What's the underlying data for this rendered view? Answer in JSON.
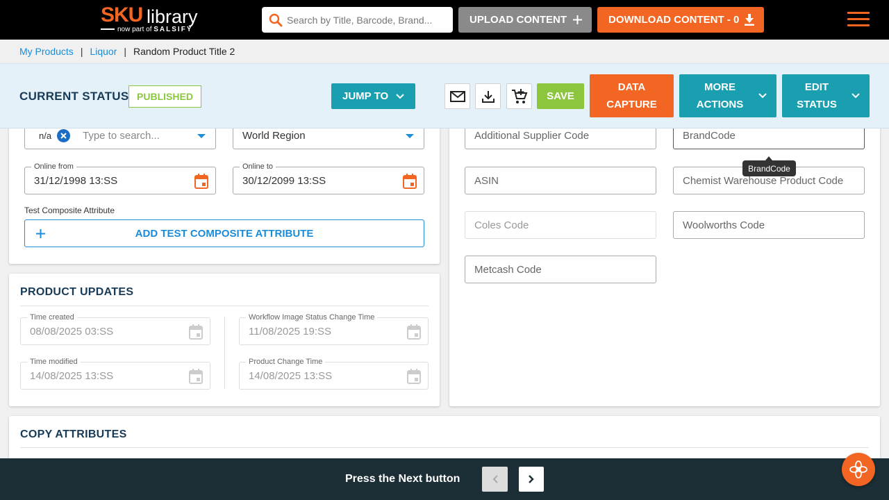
{
  "header": {
    "logo_sku": "SKU",
    "logo_library": "library",
    "logo_tagline_prefix": "now part of",
    "logo_tagline_brand": "SALSIFY",
    "search_placeholder": "Search by Title, Barcode, Brand...",
    "upload_label": "UPLOAD CONTENT",
    "download_label": "DOWNLOAD CONTENT - 0",
    "icons": [
      "search-icon",
      "plus-icon",
      "download-icon",
      "hamburger-menu-icon"
    ]
  },
  "breadcrumb": {
    "items": [
      "My Products",
      "Liquor"
    ],
    "separator": "|",
    "current": "Random Product Title 2"
  },
  "status_bar": {
    "label": "CURRENT STATUS:",
    "status": "PUBLISHED",
    "jump_to": "JUMP TO",
    "save": "SAVE",
    "data_capture_line1": "DATA",
    "data_capture_line2": "CAPTURE",
    "more_actions_line1": "MORE",
    "more_actions_line2": "ACTIONS",
    "edit_status_line1": "EDIT",
    "edit_status_line2": "STATUS",
    "icons": [
      "mail-icon",
      "download-icon",
      "add-to-cart-icon",
      "chevron-down-icon"
    ]
  },
  "left_top": {
    "chip_value": "n/a",
    "typeahead_placeholder": "Type to search...",
    "world_region": "World Region",
    "online_from_label": "Online from",
    "online_from_value": "31/12/1998 13:SS",
    "online_to_label": "Online to",
    "online_to_value": "30/12/2099 13:SS",
    "composite_label": "Test Composite Attribute",
    "add_composite": "ADD TEST COMPOSITE ATTRIBUTE"
  },
  "product_updates": {
    "title": "PRODUCT UPDATES",
    "time_created_label": "Time created",
    "time_created_value": "08/08/2025 03:SS",
    "workflow_label": "Workflow Image Status Change Time",
    "workflow_value": "11/08/2025 19:SS",
    "time_modified_label": "Time modified",
    "time_modified_value": "14/08/2025 13:SS",
    "product_change_label": "Product Change Time",
    "product_change_value": "14/08/2025 13:SS"
  },
  "right_panel": {
    "additional_supplier_code": "Additional Supplier Code",
    "brand_code": "BrandCode",
    "brand_code_tooltip": "BrandCode",
    "asin": "ASIN",
    "chemist_warehouse": "Chemist Warehouse Product Code",
    "coles_code": "Coles Code",
    "woolworths_code": "Woolworths Code",
    "metcash_code": "Metcash Code"
  },
  "copy_attributes": {
    "title": "COPY ATTRIBUTES"
  },
  "tour": {
    "text": "Press the Next button"
  },
  "colors": {
    "brand_orange": "#f26522",
    "teal": "#1a9fb1",
    "green": "#8cc63f",
    "navy": "#173a56",
    "link_blue": "#1a8cd8",
    "tour_bg": "#1c2f36"
  }
}
